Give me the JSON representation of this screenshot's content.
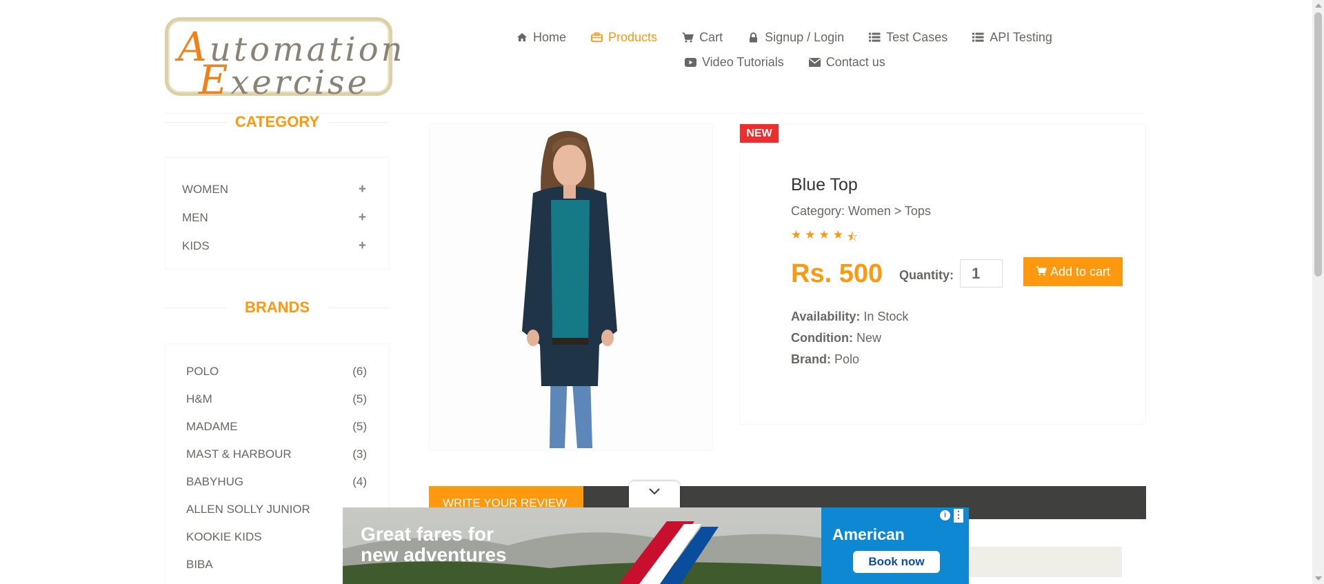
{
  "logo": {
    "line1": "Automation",
    "line2": "Exercise"
  },
  "nav": [
    {
      "label": "Home",
      "icon": "home-icon"
    },
    {
      "label": "Products",
      "icon": "briefcase-icon",
      "active": true
    },
    {
      "label": "Cart",
      "icon": "cart-icon"
    },
    {
      "label": "Signup / Login",
      "icon": "lock-icon"
    },
    {
      "label": "Test Cases",
      "icon": "list-icon"
    },
    {
      "label": "API Testing",
      "icon": "list-icon"
    },
    {
      "label": "Video Tutorials",
      "icon": "youtube-icon"
    },
    {
      "label": "Contact us",
      "icon": "envelope-icon"
    }
  ],
  "sidebar": {
    "category_title": "CATEGORY",
    "categories": [
      "WOMEN",
      "MEN",
      "KIDS"
    ],
    "brands_title": "BRANDS",
    "brands": [
      {
        "name": "POLO",
        "count": "(6)"
      },
      {
        "name": "H&M",
        "count": "(5)"
      },
      {
        "name": "MADAME",
        "count": "(5)"
      },
      {
        "name": "MAST & HARBOUR",
        "count": "(3)"
      },
      {
        "name": "BABYHUG",
        "count": "(4)"
      },
      {
        "name": "ALLEN SOLLY JUNIOR",
        "count": ""
      },
      {
        "name": "KOOKIE KIDS",
        "count": ""
      },
      {
        "name": "BIBA",
        "count": ""
      }
    ]
  },
  "product": {
    "badge": "NEW",
    "name": "Blue Top",
    "category": "Category: Women > Tops",
    "rating": 4.5,
    "price": "Rs. 500",
    "quantity_label": "Quantity:",
    "quantity": "1",
    "add_to_cart": "Add to cart",
    "availability_label": "Availability:",
    "availability": "In Stock",
    "condition_label": "Condition:",
    "condition": "New",
    "brand_label": "Brand:",
    "brand": "Polo"
  },
  "review": {
    "tab": "WRITE YOUR REVIEW"
  },
  "ad": {
    "headline1": "Great fares for",
    "headline2": "new adventures",
    "brand": "American",
    "cta": "Book now",
    "info": "i"
  },
  "colors": {
    "accent": "#fe980f",
    "badge": "#ee2d2d",
    "review_bar": "#40403e",
    "ad_blue": "#0e88d3"
  }
}
